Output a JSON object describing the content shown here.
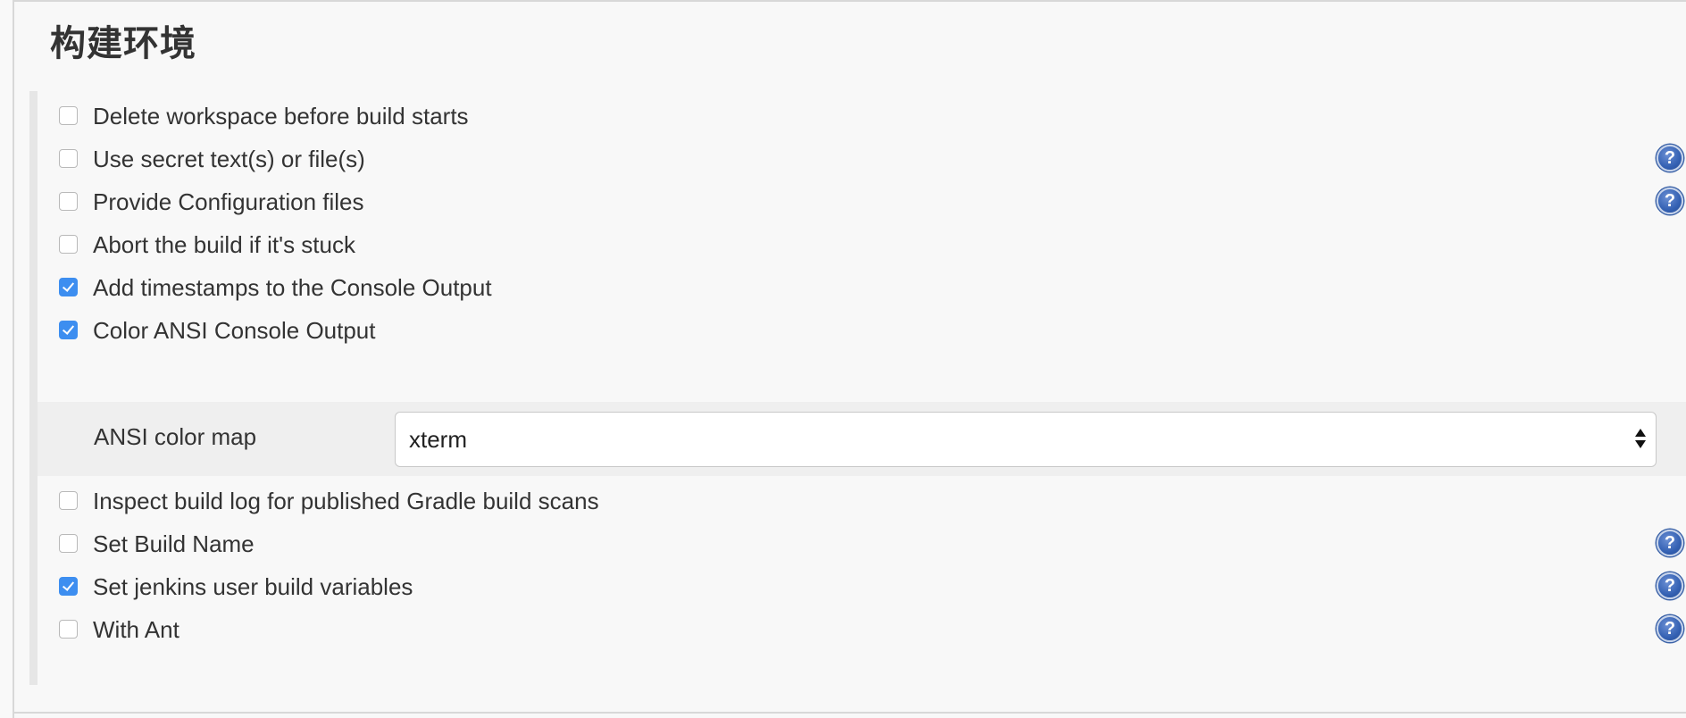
{
  "section": {
    "title": "构建环境"
  },
  "options": [
    {
      "label": "Delete workspace before build starts",
      "checked": false,
      "help": false
    },
    {
      "label": "Use secret text(s) or file(s)",
      "checked": false,
      "help": true
    },
    {
      "label": "Provide Configuration files",
      "checked": false,
      "help": true
    },
    {
      "label": "Abort the build if it's stuck",
      "checked": false,
      "help": false
    },
    {
      "label": "Add timestamps to the Console Output",
      "checked": true,
      "help": false
    },
    {
      "label": "Color ANSI Console Output",
      "checked": true,
      "help": false
    },
    {
      "label": "Inspect build log for published Gradle build scans",
      "checked": false,
      "help": false
    },
    {
      "label": "Set Build Name",
      "checked": false,
      "help": true
    },
    {
      "label": "Set jenkins user build variables",
      "checked": true,
      "help": true
    },
    {
      "label": "With Ant",
      "checked": false,
      "help": true
    }
  ],
  "ansi": {
    "label": "ANSI color map",
    "value": "xterm"
  },
  "help_glyph": "?",
  "icons": {
    "help": "help-icon",
    "checkbox": "checkbox",
    "select_arrows": "up-down-arrows-icon"
  },
  "colors": {
    "checkbox_checked": "#3d8ef0",
    "help_icon": "#3461b3"
  }
}
